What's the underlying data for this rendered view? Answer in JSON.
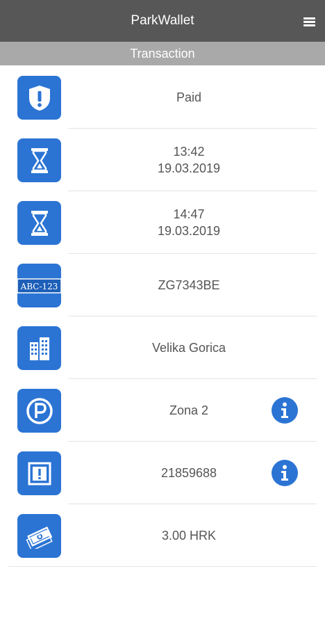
{
  "header": {
    "title": "ParkWallet",
    "menu_icon": "hamburger-menu-icon"
  },
  "subheader": {
    "title": "Transaction"
  },
  "colors": {
    "header_bg": "#575757",
    "subheader_bg": "#a9a9a9",
    "accent": "#2b74d4"
  },
  "rows": [
    {
      "icon": "shield-icon",
      "line1": "Paid"
    },
    {
      "icon": "hourglass-icon",
      "line1": "13:42",
      "line2": "19.03.2019"
    },
    {
      "icon": "hourglass-icon",
      "line1": "14:47",
      "line2": "19.03.2019"
    },
    {
      "icon": "license-plate-icon",
      "plate_text": "ABC-123",
      "line1": "ZG7343BE"
    },
    {
      "icon": "buildings-icon",
      "line1": "Velika Gorica"
    },
    {
      "icon": "parking-icon",
      "line1": "Zona 2",
      "info_icon": "info-icon"
    },
    {
      "icon": "ticket-alert-icon",
      "line1": "21859688",
      "info_icon": "info-icon"
    },
    {
      "icon": "money-icon",
      "line1": "3.00 HRK"
    }
  ]
}
